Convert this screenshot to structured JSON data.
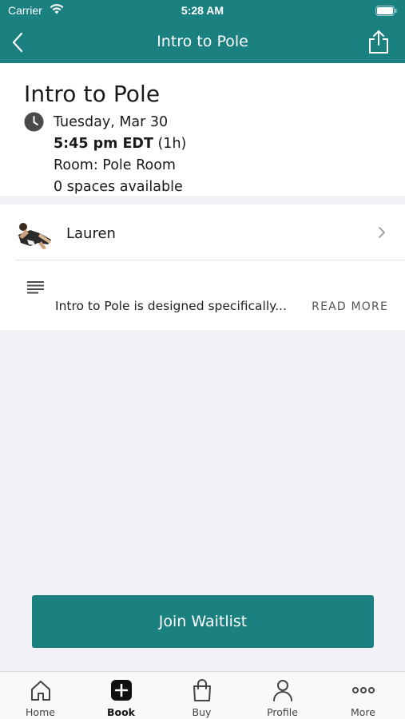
{
  "status_bar": {
    "carrier": "Carrier",
    "time": "5:28 AM"
  },
  "nav": {
    "title": "Intro to Pole"
  },
  "class_info": {
    "title": "Intro to Pole",
    "date": "Tuesday, Mar 30",
    "time": "5:45 pm EDT",
    "duration": "(1h)",
    "room": "Room: Pole Room",
    "spaces": "0 spaces available"
  },
  "instructor": {
    "name": "Lauren"
  },
  "description": {
    "text": "Intro to Pole is designed specifically...",
    "read_more": "READ MORE"
  },
  "cta": {
    "label": "Join Waitlist"
  },
  "tabs": [
    {
      "label": "Home",
      "icon": "home-icon"
    },
    {
      "label": "Book",
      "icon": "book-plus-icon",
      "active": true
    },
    {
      "label": "Buy",
      "icon": "shopping-bag-icon"
    },
    {
      "label": "Profile",
      "icon": "person-icon"
    },
    {
      "label": "More",
      "icon": "more-dots-icon"
    }
  ],
  "colors": {
    "brand": "#1b8080",
    "background": "#f2f2f6"
  }
}
